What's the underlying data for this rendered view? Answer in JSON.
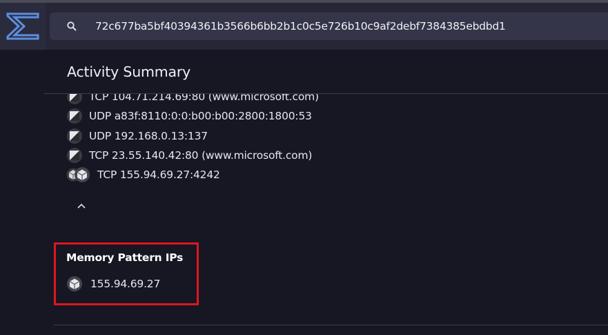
{
  "search": {
    "value": "72c677ba5bf40394361b3566b6bb2b1c0c5e726b10c9af2debf7384385ebdbd1"
  },
  "activity": {
    "title": "Activity Summary",
    "connections": [
      {
        "text": "TCP 104.71.214.69:80 (www.microsoft.com)",
        "icon": "system-icon"
      },
      {
        "text": "UDP a83f:8110:0:0:b00:b00:2800:1800:53",
        "icon": "system-icon"
      },
      {
        "text": "UDP 192.168.0.13:137",
        "icon": "system-icon"
      },
      {
        "text": "TCP 23.55.140.42:80 (www.microsoft.com)",
        "icon": "system-icon"
      },
      {
        "text": "TCP 155.94.69.27:4242",
        "icon": "package-icon"
      }
    ]
  },
  "memory": {
    "title": "Memory Pattern IPs",
    "items": [
      {
        "text": "155.94.69.27",
        "icon": "package-icon"
      }
    ]
  },
  "colors": {
    "background": "#171723",
    "topbar": "#262637",
    "search_bg": "#35354a",
    "logo_accent": "#5b8fe0",
    "highlight_border": "#e0161e"
  }
}
